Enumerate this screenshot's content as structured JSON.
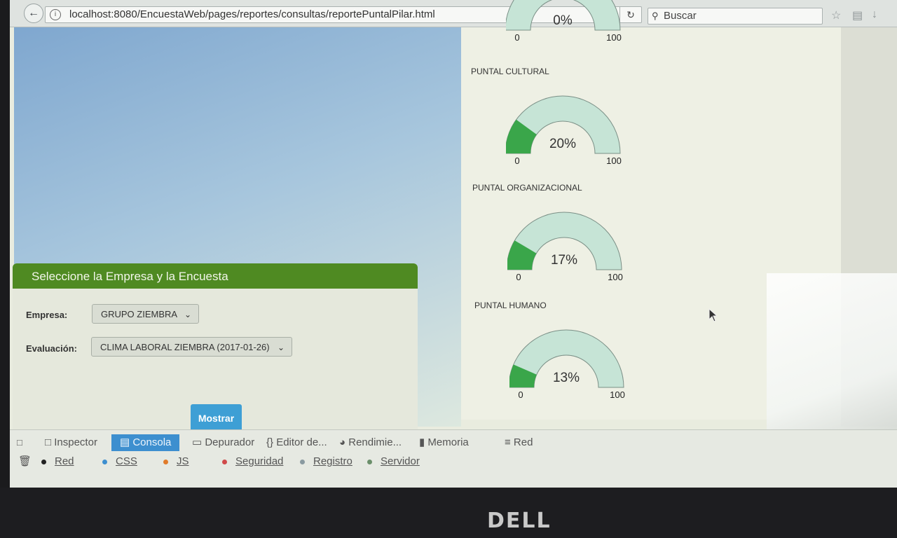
{
  "browser": {
    "url": "localhost:8080/EncuestaWeb/pages/reportes/consultas/reportePuntalPilar.html",
    "search_placeholder": "Buscar"
  },
  "gauges": [
    {
      "title": "",
      "value_text": "0%",
      "value": 0,
      "min": "0",
      "max": "100"
    },
    {
      "title": "PUNTAL CULTURAL",
      "value_text": "20%",
      "value": 20,
      "min": "0",
      "max": "100"
    },
    {
      "title": "PUNTAL ORGANIZACIONAL",
      "value_text": "17%",
      "value": 17,
      "min": "0",
      "max": "100"
    },
    {
      "title": "PUNTAL HUMANO",
      "value_text": "13%",
      "value": 13,
      "min": "0",
      "max": "100"
    }
  ],
  "gauge_colors": {
    "fill": "#3aa64a",
    "track": "#c6e4d6",
    "stroke": "#7b8f86"
  },
  "panel": {
    "title": "Seleccione la Empresa y la Encuesta",
    "empresa_label": "Empresa:",
    "empresa_value": "GRUPO ZIEMBRA",
    "evaluacion_label": "Evaluación:",
    "evaluacion_value": "CLIMA LABORAL ZIEMBRA (2017-01-26)",
    "button": "Mostrar"
  },
  "devtools": {
    "tabs": [
      "Inspector",
      "Consola",
      "Depurador",
      "Editor de...",
      "Rendimie...",
      "Memoria",
      "Red"
    ],
    "active_tab": "Consola",
    "filters": [
      "Red",
      "CSS",
      "JS",
      "Seguridad",
      "Registro",
      "Servidor"
    ],
    "filter_colors": [
      "#222222",
      "#3d8fcf",
      "#e07b2a",
      "#d04a4a",
      "#8a9aa0",
      "#6b8f6b"
    ]
  },
  "brand": "DELL"
}
